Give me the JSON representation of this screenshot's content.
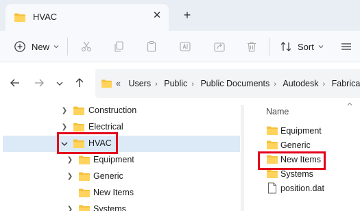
{
  "tab": {
    "title": "HVAC",
    "close_glyph": "✕",
    "new_tab_glyph": "+"
  },
  "toolbar": {
    "new_label": "New",
    "sort_label": "Sort"
  },
  "address": {
    "overflow": "«",
    "crumbs": [
      "Users",
      "Public",
      "Public Documents",
      "Autodesk",
      "Fabricat"
    ]
  },
  "nav_tree": [
    {
      "label": "Construction",
      "expanded": false,
      "level": 1
    },
    {
      "label": "Electrical",
      "expanded": false,
      "level": 1
    },
    {
      "label": "HVAC",
      "expanded": true,
      "level": 1,
      "selected": true,
      "highlighted": true
    },
    {
      "label": "Equipment",
      "expanded": false,
      "level": 2
    },
    {
      "label": "Generic",
      "expanded": false,
      "level": 2
    },
    {
      "label": "New Items",
      "expanded": false,
      "level": 2,
      "no_children": true
    },
    {
      "label": "Systems",
      "expanded": false,
      "level": 2
    }
  ],
  "content": {
    "column_header": "Name",
    "items": [
      {
        "label": "Equipment",
        "type": "folder"
      },
      {
        "label": "Generic",
        "type": "folder"
      },
      {
        "label": "New Items",
        "type": "folder",
        "highlighted": true
      },
      {
        "label": "Systems",
        "type": "folder"
      },
      {
        "label": "position.dat",
        "type": "file"
      }
    ]
  },
  "colors": {
    "accent_highlight": "#e3001b",
    "selection": "#dce9f7",
    "folder": "#f5c13d"
  }
}
